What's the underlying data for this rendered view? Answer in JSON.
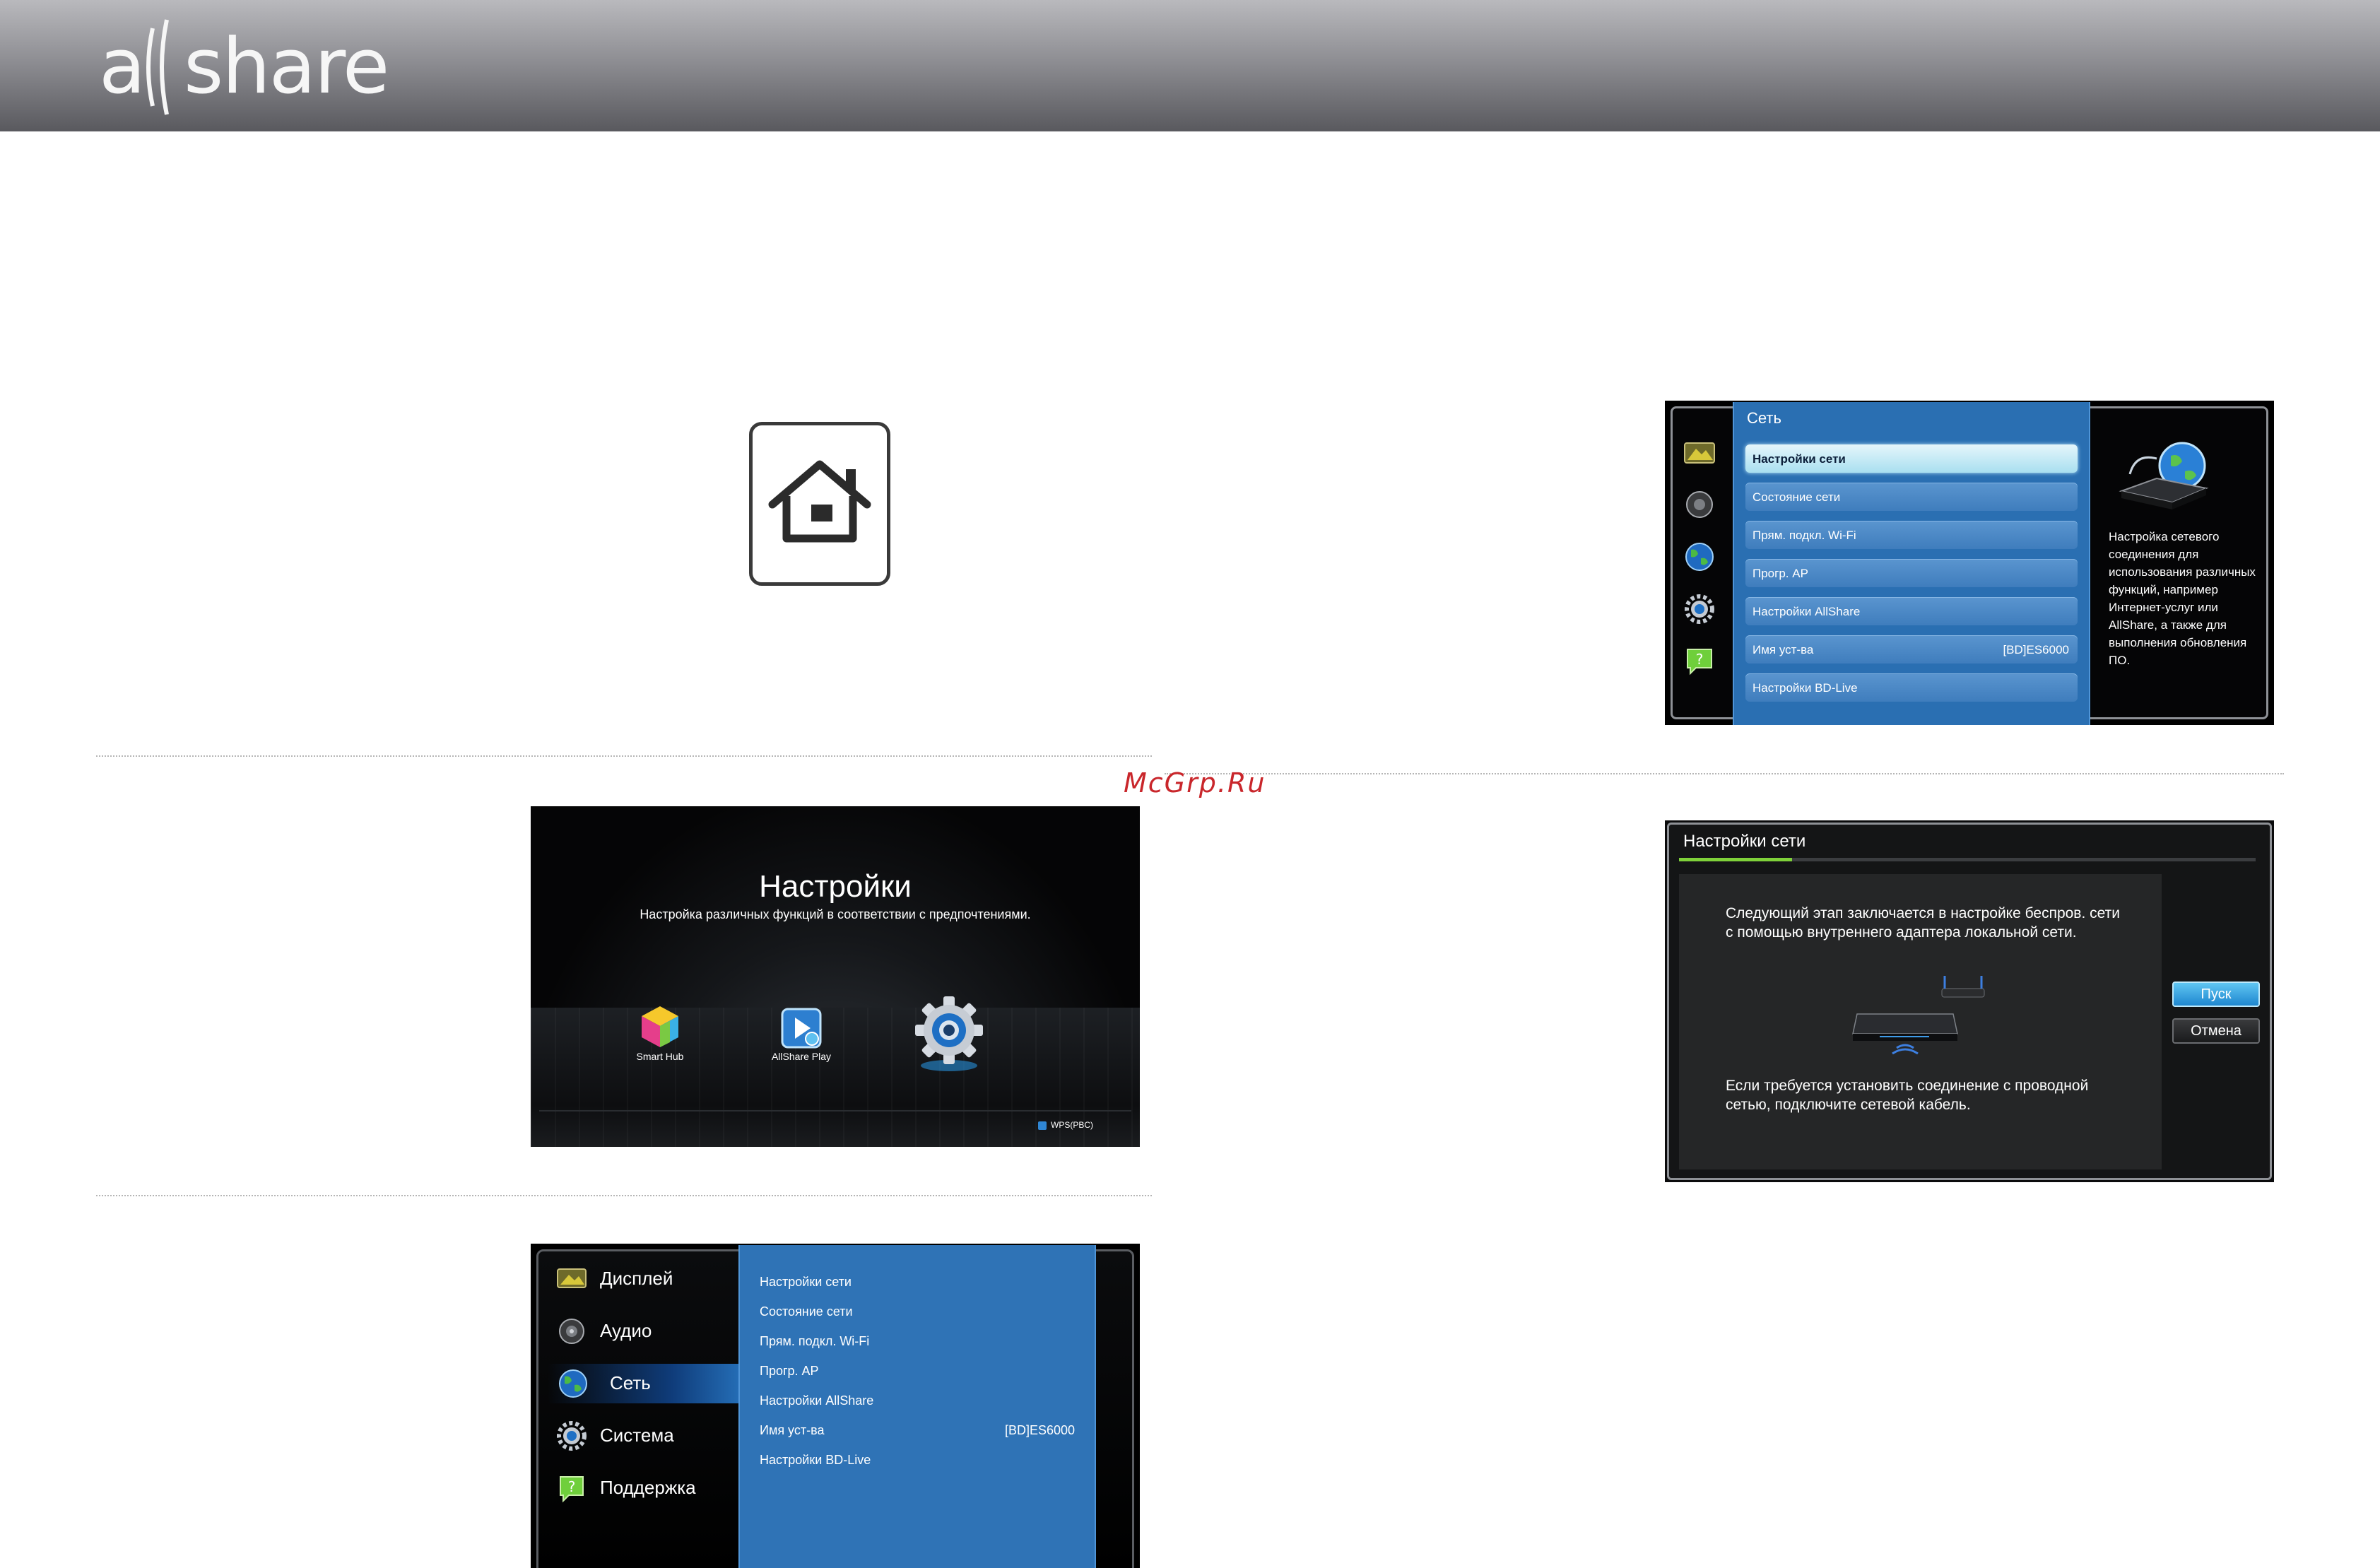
{
  "header": {
    "logo_text": "a||share",
    "logo_left": "a",
    "logo_right": "share"
  },
  "watermark": "McGrp.Ru",
  "settings_screen": {
    "title": "Настройки",
    "subtitle": "Настройка различных функций в соответствии с предпочтениями.",
    "apps": [
      {
        "label": "Smart Hub",
        "icon": "smart-hub-cube-icon"
      },
      {
        "label": "AllShare Play",
        "icon": "allshare-play-icon"
      },
      {
        "label": "",
        "icon": "settings-gear-icon"
      }
    ],
    "wps_label": "WPS(PBC)"
  },
  "menu_screen": {
    "categories": [
      {
        "label": "Дисплей",
        "icon": "display-icon"
      },
      {
        "label": "Аудио",
        "icon": "audio-icon"
      },
      {
        "label": "Сеть",
        "icon": "globe-icon",
        "active": true
      },
      {
        "label": "Система",
        "icon": "gear-icon"
      },
      {
        "label": "Поддержка",
        "icon": "support-icon"
      }
    ],
    "items": [
      {
        "label": "Настройки сети",
        "value": ""
      },
      {
        "label": "Состояние сети",
        "value": ""
      },
      {
        "label": "Прям. подкл. Wi-Fi",
        "value": ""
      },
      {
        "label": "Прогр. AP",
        "value": ""
      },
      {
        "label": "Настройки AllShare",
        "value": ""
      },
      {
        "label": "Имя уст-ва",
        "value": "[BD]ES6000"
      },
      {
        "label": "Настройки BD-Live",
        "value": ""
      }
    ]
  },
  "network_screen": {
    "panel_title": "Сеть",
    "items": [
      {
        "label": "Настройки сети",
        "value": "",
        "selected": true
      },
      {
        "label": "Состояние сети",
        "value": ""
      },
      {
        "label": "Прям. подкл. Wi-Fi",
        "value": ""
      },
      {
        "label": "Прогр. AP",
        "value": ""
      },
      {
        "label": "Настройки AllShare",
        "value": ""
      },
      {
        "label": "Имя уст-ва",
        "value": "[BD]ES6000"
      },
      {
        "label": "Настройки BD-Live",
        "value": ""
      }
    ],
    "description": "Настройка сетевого соединения для использования различных функций, например Интернет-услуг или AllShare, а также для выполнения обновления ПО."
  },
  "network_dialog": {
    "title": "Настройки сети",
    "text_top": "Следующий этап заключается в настройке беспров. сети с помощью внутреннего адаптера локальной сети.",
    "text_bottom": "Если требуется установить соединение с проводной сетью, подключите сетевой кабель.",
    "start_button": "Пуск",
    "cancel_button": "Отмена",
    "progress_step": 1,
    "progress_steps_total": 5
  }
}
